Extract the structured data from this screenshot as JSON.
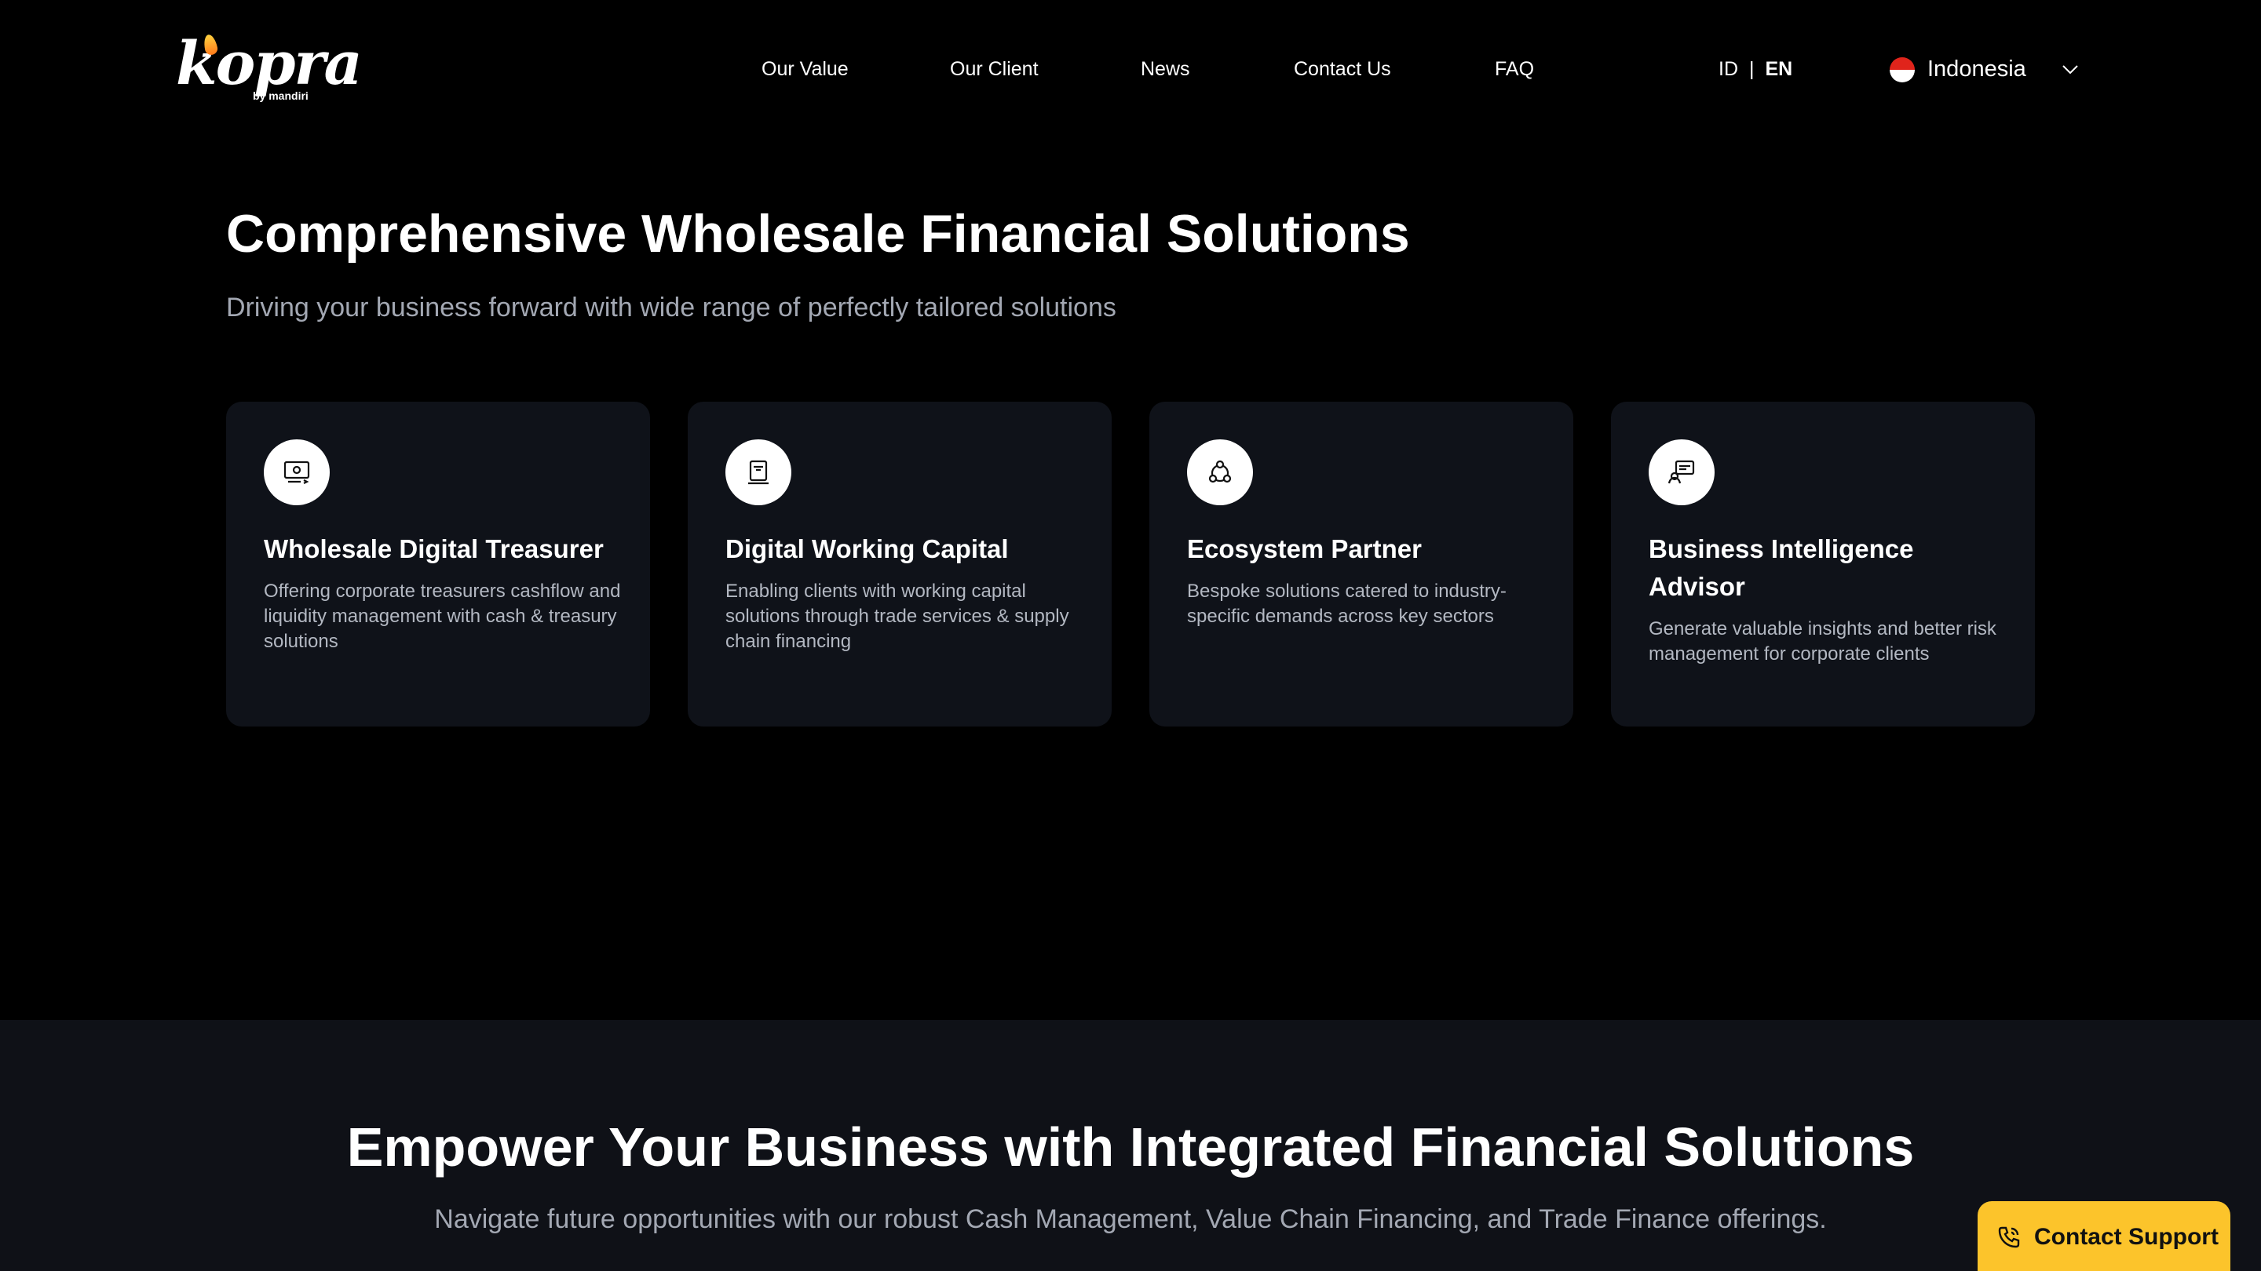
{
  "header": {
    "logo": {
      "word": "kopra",
      "sub": "by mandiri"
    },
    "nav": [
      {
        "label": "Our Value"
      },
      {
        "label": "Our Client"
      },
      {
        "label": "News"
      },
      {
        "label": "Contact Us"
      },
      {
        "label": "FAQ"
      }
    ],
    "language": {
      "id": "ID",
      "separator": "|",
      "en": "EN",
      "active": "EN"
    },
    "country": {
      "name": "Indonesia",
      "flag": "indonesia-flag-icon"
    }
  },
  "solutions": {
    "title": "Comprehensive Wholesale Financial Solutions",
    "subtitle": "Driving your business forward with wide range of perfectly tailored solutions",
    "cards": [
      {
        "icon": "treasury-icon",
        "title": "Wholesale Digital Treasurer",
        "description": "Offering corporate treasurers cashflow and liquidity management with cash & treasury solutions"
      },
      {
        "icon": "working-capital-icon",
        "title": "Digital Working Capital",
        "description": "Enabling clients with working capital solutions through trade services & supply chain financing"
      },
      {
        "icon": "ecosystem-icon",
        "title": "Ecosystem Partner",
        "description": "Bespoke solutions catered to industry-specific demands across key sectors"
      },
      {
        "icon": "business-intelligence-icon",
        "title": "Business Intelligence Advisor",
        "description": "Generate valuable insights and better risk management for corporate clients"
      }
    ]
  },
  "integrated": {
    "title": "Empower Your Business with Integrated Financial Solutions",
    "subtitle": "Navigate future opportunities with our robust Cash Management, Value Chain Financing, and Trade Finance offerings."
  },
  "support": {
    "label": "Contact Support",
    "icon": "phone-icon"
  },
  "colors": {
    "background": "#000000",
    "card_background": "#0f1219",
    "lower_background": "#0f1117",
    "muted_text": "#a3a8b3",
    "support_button": "#fcc42b"
  }
}
